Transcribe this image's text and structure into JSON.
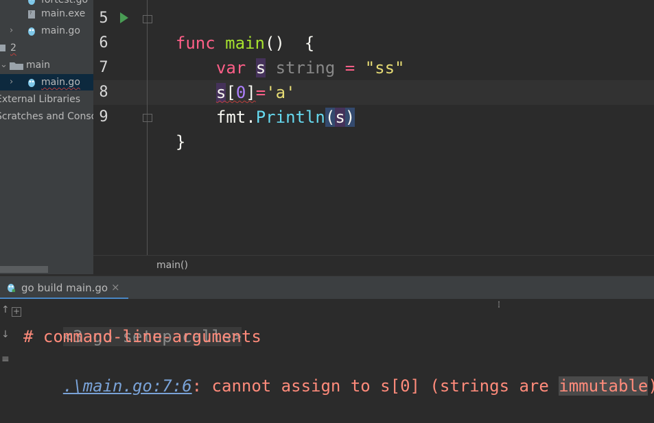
{
  "sidebar": {
    "items": [
      {
        "label": "fortest.go",
        "type": "go-file"
      },
      {
        "label": "main.exe",
        "type": "exe-file"
      },
      {
        "label": "main.go",
        "type": "go-file"
      },
      {
        "label": "2",
        "type": "module"
      },
      {
        "label": "main",
        "type": "folder"
      },
      {
        "label": "main.go",
        "type": "go-file",
        "selected": true
      },
      {
        "label": "External Libraries",
        "type": "library"
      },
      {
        "label": "Scratches and Consoles",
        "type": "scratches"
      }
    ]
  },
  "editor": {
    "line_numbers": [
      "5",
      "6",
      "7",
      "8",
      "9"
    ],
    "code": {
      "l5": {
        "kw": "func",
        "fn": "main",
        "rest": "()  {"
      },
      "l6": {
        "kw": "var",
        "ident": "s",
        "typ": "string",
        "op": "=",
        "str": "\"ss\""
      },
      "l7": {
        "a": "s",
        "b": "[",
        "c": "0",
        "d": "]",
        "e": "=",
        "f": "'a'"
      },
      "l8": {
        "pkg": "fmt",
        "dot": ".",
        "call": "Println",
        "lp": "(",
        "arg": "s",
        "rp": ")"
      },
      "l9": {
        "text": "}"
      }
    },
    "breadcrumb": "main()"
  },
  "run": {
    "tab_label": "go build main.go",
    "close": "×",
    "console": {
      "setup_calls": "<3 go setup calls>",
      "header": "# command-line-arguments",
      "error_link": ".\\main.go:7:6",
      "error_msg": ": cannot assign to s[0] (strings are ",
      "error_word": "immutable",
      "error_end": ")"
    }
  },
  "colors": {
    "sidebar_bg": "#3c3f41",
    "editor_bg": "#2b2b2b",
    "keyword": "#ff5f88",
    "function": "#a6e22e",
    "string": "#e6db74",
    "error_text": "#ff8b7b",
    "link": "#7aa3d8",
    "accent": "#4a88c7"
  }
}
